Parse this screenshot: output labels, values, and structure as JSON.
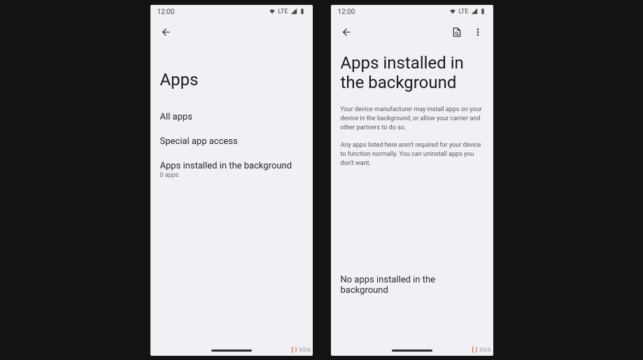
{
  "statusbar": {
    "time": "12:00",
    "network": "LTE"
  },
  "watermark": {
    "bracket_left": "[ }",
    "text": "XDA"
  },
  "screen1": {
    "title": "Apps",
    "items": [
      {
        "label": "All apps"
      },
      {
        "label": "Special app access"
      },
      {
        "label": "Apps installed in the background",
        "sub": "0 apps"
      }
    ]
  },
  "screen2": {
    "title": "Apps installed in the background",
    "info1": "Your device manufacturer may install apps on your device in the background, or allow your carrier and other partners to do so.",
    "info2": "Any apps listed here aren't required for your device to function normally. You can uninstall apps you don't want.",
    "empty": "No apps installed in the background"
  }
}
